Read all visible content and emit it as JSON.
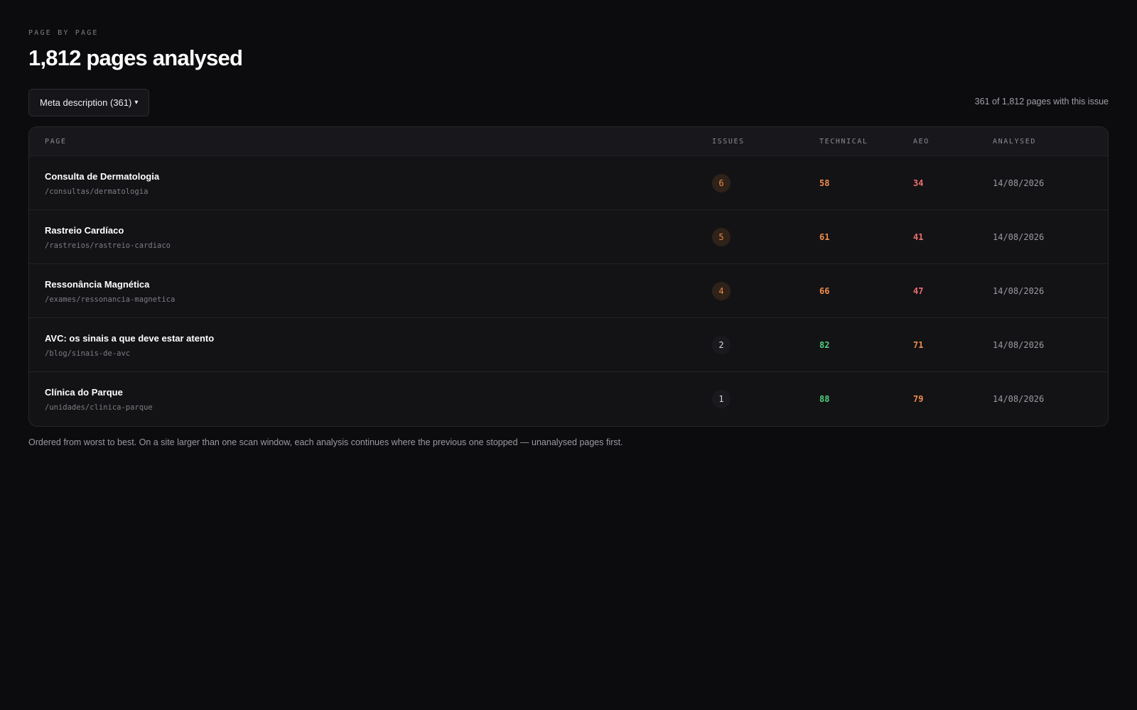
{
  "header": {
    "eyebrow": "PAGE BY PAGE",
    "title": "1,812 pages analysed"
  },
  "filter": {
    "label": "Meta description (361)",
    "caret": "▾"
  },
  "count_note": "361 of 1,812 pages with this issue",
  "table": {
    "columns": [
      "PAGE",
      "ISSUES",
      "TECHNICAL",
      "AEO",
      "ANALYSED"
    ],
    "rows": [
      {
        "title": "Consulta de Dermatologia",
        "path": "/consultas/dermatologia",
        "issues": "6",
        "issues_level": "warn",
        "technical": "58",
        "technical_color": "#f08b4b",
        "aeo": "34",
        "aeo_color": "#ee6e6e",
        "analysed": "14/08/2026"
      },
      {
        "title": "Rastreio Cardíaco",
        "path": "/rastreios/rastreio-cardiaco",
        "issues": "5",
        "issues_level": "warn",
        "technical": "61",
        "technical_color": "#f08b4b",
        "aeo": "41",
        "aeo_color": "#ee6e6e",
        "analysed": "14/08/2026"
      },
      {
        "title": "Ressonância Magnética",
        "path": "/exames/ressonancia-magnetica",
        "issues": "4",
        "issues_level": "warn",
        "technical": "66",
        "technical_color": "#f08b4b",
        "aeo": "47",
        "aeo_color": "#ee6e6e",
        "analysed": "14/08/2026"
      },
      {
        "title": "AVC: os sinais a que deve estar atento",
        "path": "/blog/sinais-de-avc",
        "issues": "2",
        "issues_level": "ok",
        "technical": "82",
        "technical_color": "#4fcf7c",
        "aeo": "71",
        "aeo_color": "#f08b4b",
        "analysed": "14/08/2026"
      },
      {
        "title": "Clínica do Parque",
        "path": "/unidades/clinica-parque",
        "issues": "1",
        "issues_level": "ok",
        "technical": "88",
        "technical_color": "#4fcf7c",
        "aeo": "79",
        "aeo_color": "#f08b4b",
        "analysed": "14/08/2026"
      }
    ]
  },
  "footnote": "Ordered from worst to best. On a site larger than one scan window, each analysis continues where the previous one stopped — unanalysed pages first."
}
